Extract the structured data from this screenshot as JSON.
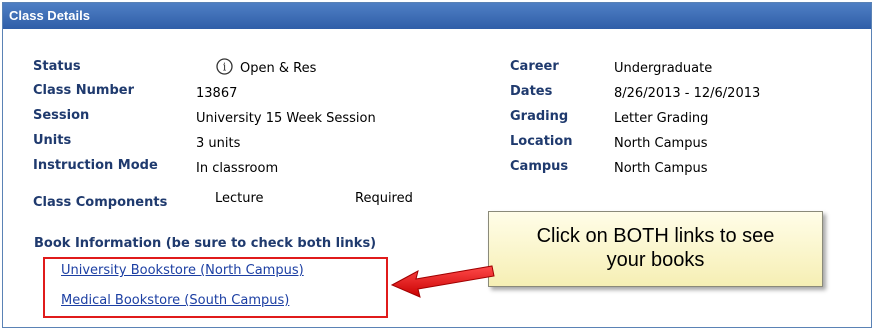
{
  "panel": {
    "title": "Class Details"
  },
  "left_fields": [
    {
      "label": "Status",
      "value": "Open & Res"
    },
    {
      "label": "Class Number",
      "value": "13867"
    },
    {
      "label": "Session",
      "value": "University 15 Week Session"
    },
    {
      "label": "Units",
      "value": "3 units"
    },
    {
      "label": "Instruction Mode",
      "value": "In classroom"
    }
  ],
  "right_fields": [
    {
      "label": "Career",
      "value": "Undergraduate"
    },
    {
      "label": "Dates",
      "value": "8/26/2013 - 12/6/2013"
    },
    {
      "label": "Grading",
      "value": "Letter Grading"
    },
    {
      "label": "Location",
      "value": "North Campus"
    },
    {
      "label": "Campus",
      "value": "North Campus"
    }
  ],
  "components": {
    "label": "Class Components",
    "type": "Lecture",
    "requirement": "Required"
  },
  "book_info": {
    "heading": "Book Information (be sure to check both links)",
    "links": [
      "University Bookstore (North Campus)",
      "Medical Bookstore (South Campus)"
    ]
  },
  "callout": {
    "line1": "Click on BOTH links to see",
    "line2": "your books"
  },
  "icons": {
    "status_icon": "info-icon"
  },
  "colors": {
    "header": "#2f5ea8",
    "label": "#1f3a6e",
    "link": "#1c3fa3",
    "highlight": "#e01b1b",
    "callout_bg": "#fdf8c8"
  }
}
